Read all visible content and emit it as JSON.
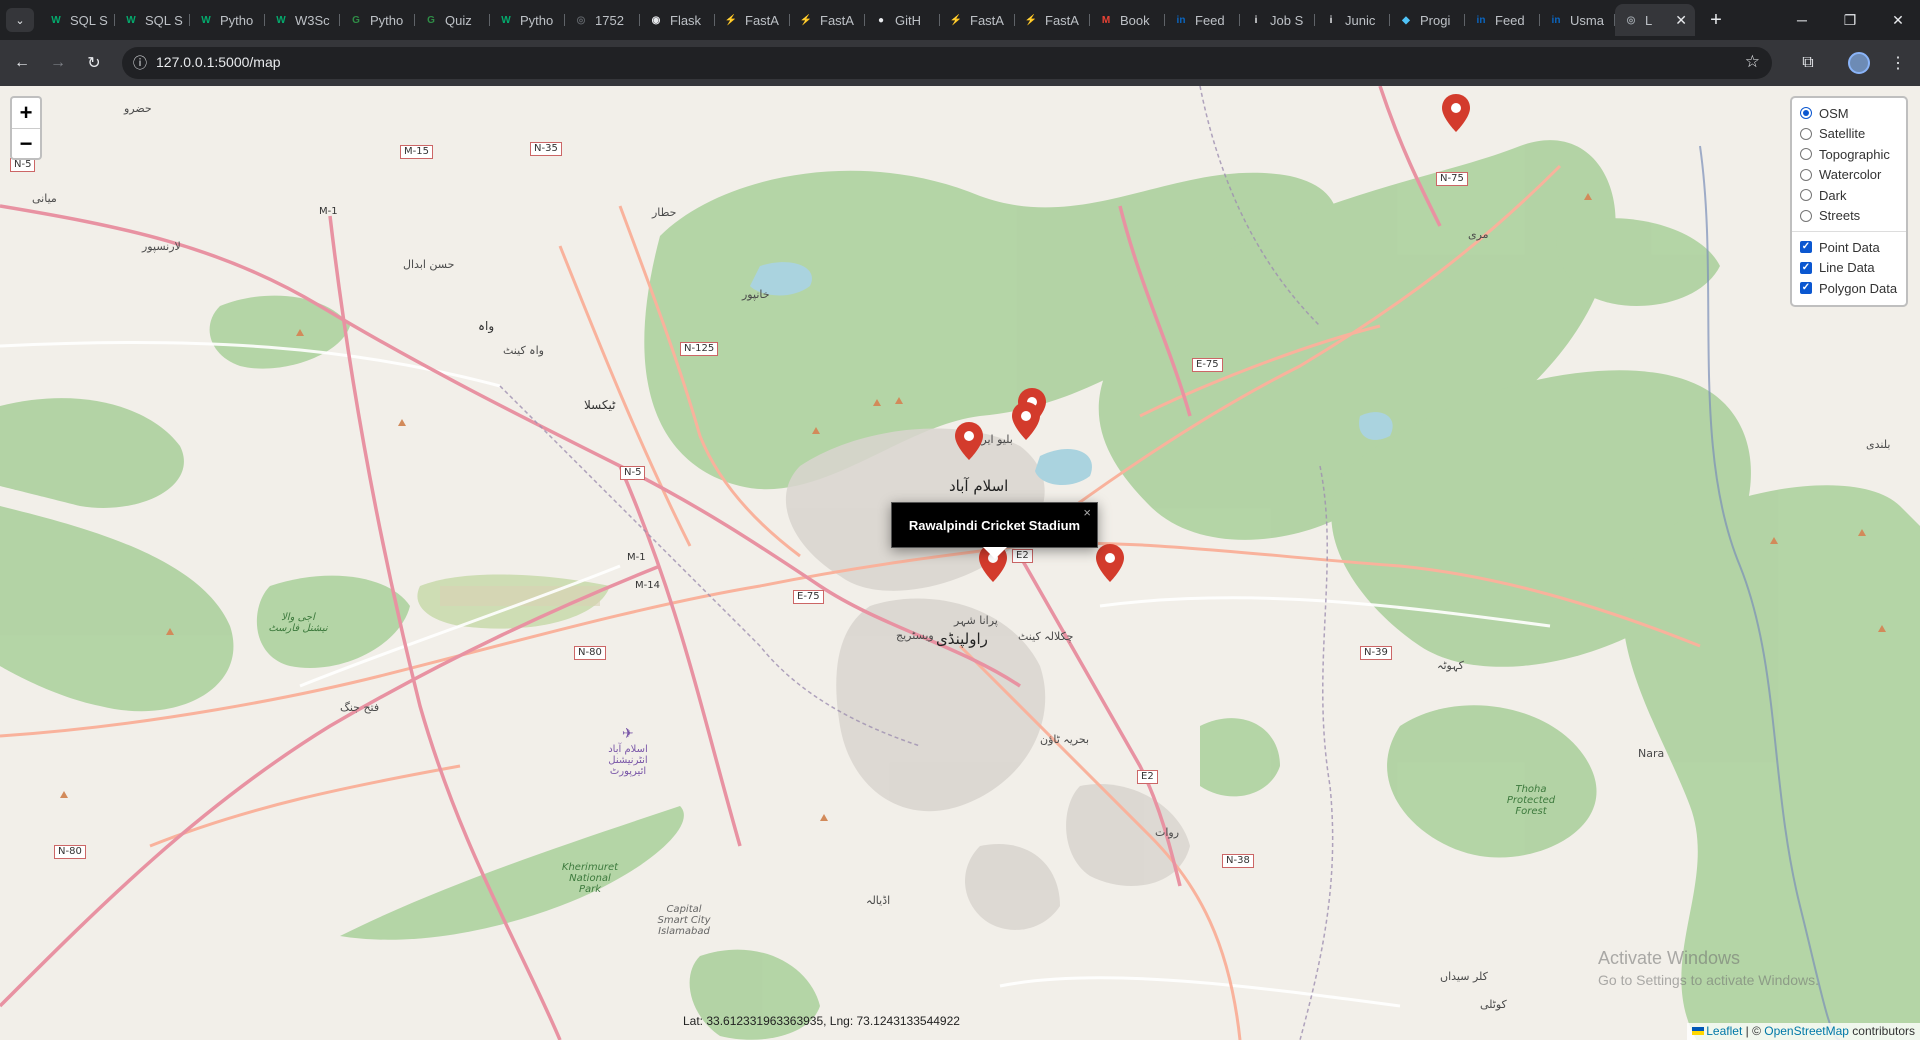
{
  "browser": {
    "tabs": [
      {
        "label": "SQL S",
        "icon": "w3schools-icon",
        "color": "#04aa6d",
        "glyph": "W"
      },
      {
        "label": "SQL S",
        "icon": "w3schools-icon",
        "color": "#04aa6d",
        "glyph": "W"
      },
      {
        "label": "Pytho",
        "icon": "w3schools-icon",
        "color": "#04aa6d",
        "glyph": "W"
      },
      {
        "label": "W3Sc",
        "icon": "w3schools-icon",
        "color": "#04aa6d",
        "glyph": "W"
      },
      {
        "label": "Pytho",
        "icon": "geeksforgeeks-icon",
        "color": "#2f8d46",
        "glyph": "G"
      },
      {
        "label": "Quiz",
        "icon": "geeksforgeeks-icon",
        "color": "#2f8d46",
        "glyph": "G"
      },
      {
        "label": "Pytho",
        "icon": "w3schools-icon",
        "color": "#04aa6d",
        "glyph": "W"
      },
      {
        "label": "1752",
        "icon": "globe-icon",
        "color": "#5f6368",
        "glyph": "◎"
      },
      {
        "label": "Flask",
        "icon": "flask-icon",
        "color": "#e8eaed",
        "glyph": "◉"
      },
      {
        "label": "FastA",
        "icon": "fastapi-icon",
        "color": "#009688",
        "glyph": "⚡"
      },
      {
        "label": "FastA",
        "icon": "fastapi-icon",
        "color": "#009688",
        "glyph": "⚡"
      },
      {
        "label": "GitH",
        "icon": "github-icon",
        "color": "#e8eaed",
        "glyph": "●"
      },
      {
        "label": "FastA",
        "icon": "fastapi-icon",
        "color": "#009688",
        "glyph": "⚡"
      },
      {
        "label": "FastA",
        "icon": "fastapi-icon",
        "color": "#009688",
        "glyph": "⚡"
      },
      {
        "label": "Book",
        "icon": "gmail-icon",
        "color": "#ea4335",
        "glyph": "M"
      },
      {
        "label": "Feed",
        "icon": "linkedin-icon",
        "color": "#0a66c2",
        "glyph": "in"
      },
      {
        "label": "Job S",
        "icon": "info-icon",
        "color": "#e8eaed",
        "glyph": "i"
      },
      {
        "label": "Junic",
        "icon": "info-icon",
        "color": "#e8eaed",
        "glyph": "i"
      },
      {
        "label": "Progi",
        "icon": "shield-icon",
        "color": "#4fc3f7",
        "glyph": "◆"
      },
      {
        "label": "Feed",
        "icon": "linkedin-icon",
        "color": "#0a66c2",
        "glyph": "in"
      },
      {
        "label": "Usma",
        "icon": "linkedin-icon",
        "color": "#0a66c2",
        "glyph": "in"
      }
    ],
    "active_tab": {
      "label": "L",
      "icon": "globe-icon"
    },
    "url": "127.0.0.1:5000/map"
  },
  "map": {
    "zoom_in": "+",
    "zoom_out": "−",
    "base_layers": [
      "OSM",
      "Satellite",
      "Topographic",
      "Watercolor",
      "Dark",
      "Streets"
    ],
    "selected_base_layer": "OSM",
    "overlays": [
      {
        "label": "Point Data",
        "checked": true
      },
      {
        "label": "Line Data",
        "checked": true
      },
      {
        "label": "Polygon Data",
        "checked": true
      }
    ],
    "popup": {
      "title": "Rawalpindi Cricket Stadium",
      "close": "×"
    },
    "coordinates": "Lat: 33.612331963363935, Lng: 73.1243133544922",
    "attribution": {
      "leaflet": "Leaflet",
      "separator": " | © ",
      "osm": "OpenStreetMap",
      "suffix": " contributors"
    },
    "watermark": {
      "title": "Activate Windows",
      "subtitle": "Go to Settings to activate Windows."
    },
    "labels": {
      "islamabad": "اسلام آباد",
      "rawalpindi": "راولپنڈی",
      "taxila": "ٹیکسلا",
      "wah": "واہ",
      "wah_cantt": "واہ کینٹ",
      "fateh_jang": "فتح جنگ",
      "bahria_town": "بحریہ ٹاؤن",
      "rawat": "روات",
      "kahuta": "کہوٹہ",
      "nara": "Nara",
      "kallar_syedan": "کلر سیداں",
      "chaklala": "چکلالہ کینٹ",
      "purana_shehar": "پرانا شہر",
      "westridge": "ویسٹریج",
      "hazro": "حضرو",
      "hattar": "حطار",
      "khanpur": "خانپور",
      "hasan_abdal": "حسن ابدال",
      "lawrencepur": "لارنسپور",
      "mianwali": "میانی",
      "adiala": "اڈیالہ",
      "blue_area": "بلیو ایریا",
      "murree": "مری",
      "kotli": "کوٹلی",
      "pindi_gheb": "بلندی",
      "khairimurat": "Kherimuret National Park",
      "capital_smart_city": "Capital Smart City Islamabad",
      "thoha": "Thoha Protected Forest",
      "airport": "اسلام آباد انٹرنیشنل ائیرپورٹ",
      "kala_chitta": "اجی والا نیشنل فارسٹ"
    },
    "road_shields": [
      "M-15",
      "N-35",
      "N-5",
      "M-1",
      "N-125",
      "N-5",
      "M-1",
      "M-14",
      "E-75",
      "N-80",
      "E2",
      "E2",
      "E-75",
      "N-75",
      "N-39",
      "N-38",
      "N-80"
    ]
  },
  "colors": {
    "marker": "#d33b2c",
    "popup_bg": "#000000",
    "forest": "#add19e",
    "motorway": "#e892a2",
    "trunk": "#f9b29c",
    "water": "#aad3df"
  }
}
